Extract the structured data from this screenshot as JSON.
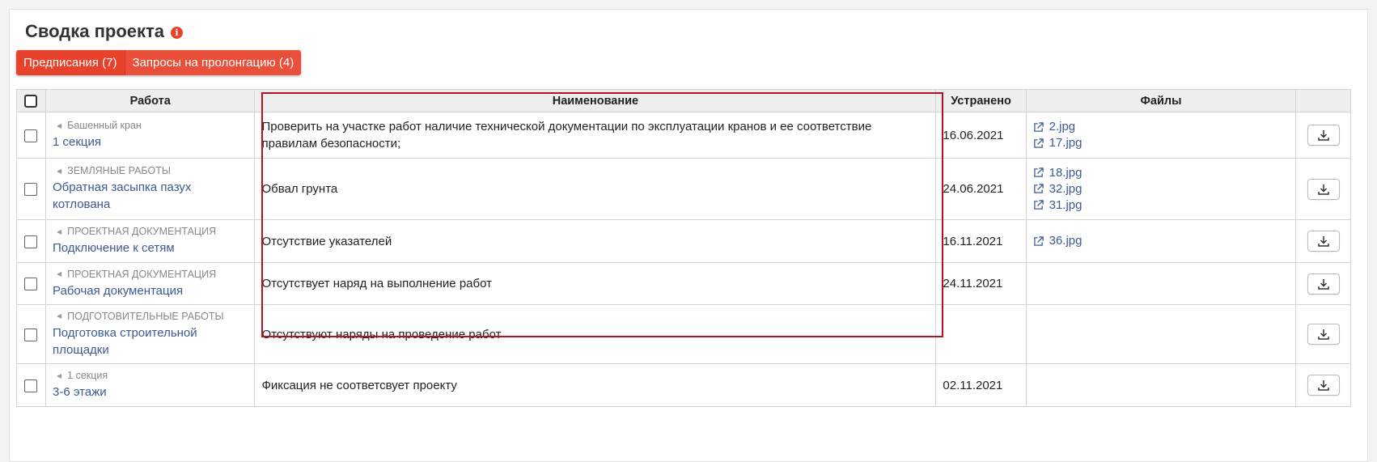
{
  "page": {
    "title": "Сводка проекта",
    "info_icon": "info-icon",
    "accent_color": "#e8412c"
  },
  "tabs": [
    {
      "label": "Предписания (7)"
    },
    {
      "label": "Запросы на пролонгацию (4)"
    }
  ],
  "table": {
    "headers": {
      "work": "Работа",
      "name": "Наименование",
      "fixed": "Устранено",
      "files": "Файлы"
    },
    "rows": [
      {
        "parent": "Башенный кран",
        "work": "1 секция",
        "name": "Проверить на участке работ наличие технической документации по эксплуатации кранов и ее соответствие правилам безопасности;",
        "fixed": "16.06.2021",
        "files": [
          "2.jpg",
          "17.jpg"
        ]
      },
      {
        "parent": "ЗЕМЛЯНЫЕ РАБОТЫ",
        "work": "Обратная засыпка пазух котлована",
        "name": "Обвал грунта",
        "fixed": "24.06.2021",
        "files": [
          "18.jpg",
          "32.jpg",
          "31.jpg"
        ]
      },
      {
        "parent": "ПРОЕКТНАЯ ДОКУМЕНТАЦИЯ",
        "work": "Подключение к сетям",
        "name": "Отсутствие указателей",
        "fixed": "16.11.2021",
        "files": [
          "36.jpg"
        ]
      },
      {
        "parent": "ПРОЕКТНАЯ ДОКУМЕНТАЦИЯ",
        "work": "Рабочая документация",
        "name": "Отсутствует наряд на выполнение работ",
        "fixed": "24.11.2021",
        "files": []
      },
      {
        "parent": "ПОДГОТОВИТЕЛЬНЫЕ РАБОТЫ",
        "work": "Подготовка строительной площадки",
        "name": "Отсутствуют наряды на проведение работ",
        "fixed": "",
        "files": []
      },
      {
        "parent": "1 секция",
        "work": "3-6 этажи",
        "name": "Фиксация не соответсвует проекту",
        "fixed": "02.11.2021",
        "files": []
      }
    ]
  }
}
